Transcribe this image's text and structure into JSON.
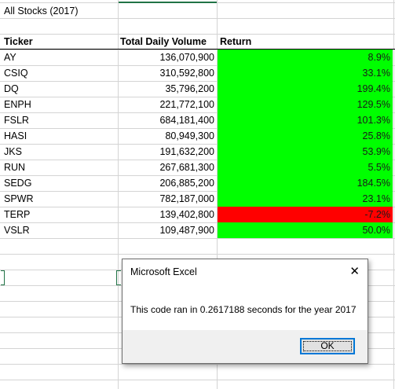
{
  "sheet": {
    "title": "All Stocks (2017)",
    "headers": {
      "ticker": "Ticker",
      "volume": "Total Daily Volume",
      "return": "Return"
    },
    "rows": [
      {
        "ticker": "AY",
        "volume": "136,070,900",
        "return": "8.9%",
        "status": "positive"
      },
      {
        "ticker": "CSIQ",
        "volume": "310,592,800",
        "return": "33.1%",
        "status": "positive"
      },
      {
        "ticker": "DQ",
        "volume": "35,796,200",
        "return": "199.4%",
        "status": "positive"
      },
      {
        "ticker": "ENPH",
        "volume": "221,772,100",
        "return": "129.5%",
        "status": "positive"
      },
      {
        "ticker": "FSLR",
        "volume": "684,181,400",
        "return": "101.3%",
        "status": "positive"
      },
      {
        "ticker": "HASI",
        "volume": "80,949,300",
        "return": "25.8%",
        "status": "positive"
      },
      {
        "ticker": "JKS",
        "volume": "191,632,200",
        "return": "53.9%",
        "status": "positive"
      },
      {
        "ticker": "RUN",
        "volume": "267,681,300",
        "return": "5.5%",
        "status": "positive"
      },
      {
        "ticker": "SEDG",
        "volume": "206,885,200",
        "return": "184.5%",
        "status": "positive"
      },
      {
        "ticker": "SPWR",
        "volume": "782,187,000",
        "return": "23.1%",
        "status": "positive"
      },
      {
        "ticker": "TERP",
        "volume": "139,402,800",
        "return": "-7.2%",
        "status": "negative"
      },
      {
        "ticker": "VSLR",
        "volume": "109,487,900",
        "return": "50.0%",
        "status": "positive"
      }
    ],
    "colors": {
      "positive": "#00ff00",
      "negative": "#ff0000",
      "gridline": "#d4d4d4"
    }
  },
  "dialog": {
    "title": "Microsoft Excel",
    "message": "This code ran in 0.2617188 seconds for the year 2017",
    "ok_label": "OK",
    "close_icon": "close-icon"
  }
}
